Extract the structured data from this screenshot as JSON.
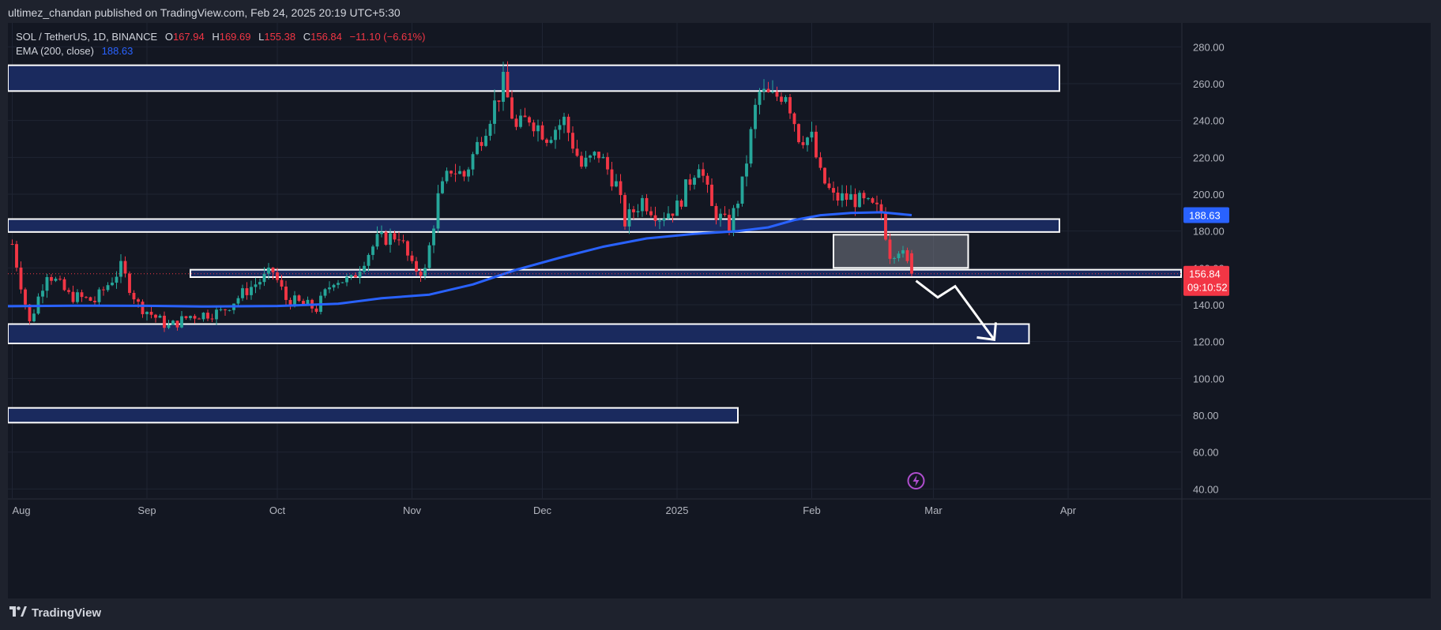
{
  "header": {
    "published_line": "ultimez_chandan published on TradingView.com, Feb 24, 2025 20:19 UTC+5:30"
  },
  "legend": {
    "symbol": "SOL / TetherUS, 1D, BINANCE",
    "open_label": "O",
    "open": "167.94",
    "high_label": "H",
    "high": "169.69",
    "low_label": "L",
    "low": "155.38",
    "close_label": "C",
    "close": "156.84",
    "change": "−11.10 (−6.61%)",
    "ema_label": "EMA (200, close)",
    "ema_value": "188.63"
  },
  "footer": {
    "brand": "TradingView",
    "logo_icon": "tradingview-logo-icon"
  },
  "colors": {
    "up": "#26a69a",
    "down": "#f23645",
    "ema": "#2962ff",
    "zone_fill": "#1a2a5e",
    "zone_stroke": "#ffffff",
    "price_badge": "#f23645"
  },
  "chart_data": {
    "type": "candlestick",
    "symbol": "SOL / TetherUS",
    "timeframe": "1D",
    "exchange": "BINANCE",
    "ylim": [
      35,
      293
    ],
    "y_ticks": [
      "280.00",
      "260.00",
      "240.00",
      "220.00",
      "200.00",
      "180.00",
      "160.00",
      "140.00",
      "120.00",
      "100.00",
      "80.00",
      "60.00",
      "40.00"
    ],
    "y_tick_values": [
      280,
      260,
      240,
      220,
      200,
      180,
      160,
      140,
      120,
      100,
      80,
      60,
      40
    ],
    "x_ticks": [
      "Aug",
      "Sep",
      "Oct",
      "Nov",
      "Dec",
      "2025",
      "Feb",
      "Mar",
      "Apr"
    ],
    "x_tick_dates": [
      "2024-08-01",
      "2024-09-01",
      "2024-10-01",
      "2024-11-01",
      "2024-12-01",
      "2025-01-01",
      "2025-02-01",
      "2025-03-01",
      "2025-04-01"
    ],
    "xlim": [
      "2024-07-31",
      "2025-04-27"
    ],
    "last_price": "156.84",
    "countdown": "09:10:52",
    "ema_badge": "188.63",
    "ema_200": [
      [
        "2024-07-31",
        139.2
      ],
      [
        "2024-08-15",
        139.5
      ],
      [
        "2024-09-01",
        139.4
      ],
      [
        "2024-09-15",
        139.0
      ],
      [
        "2024-10-01",
        139.3
      ],
      [
        "2024-10-15",
        140.5
      ],
      [
        "2024-10-25",
        143.5
      ],
      [
        "2024-11-05",
        145.5
      ],
      [
        "2024-11-15",
        151
      ],
      [
        "2024-11-25",
        159
      ],
      [
        "2024-12-05",
        165.5
      ],
      [
        "2024-12-15",
        171.5
      ],
      [
        "2024-12-25",
        176
      ],
      [
        "2025-01-05",
        178.5
      ],
      [
        "2025-01-15",
        180
      ],
      [
        "2025-01-22",
        182
      ],
      [
        "2025-01-28",
        186
      ],
      [
        "2025-02-03",
        188.6
      ],
      [
        "2025-02-10",
        189.8
      ],
      [
        "2025-02-17",
        190.2
      ],
      [
        "2025-02-24",
        188.63
      ]
    ],
    "zones": [
      {
        "name": "resistance-zone-260",
        "low": 256,
        "high": 270,
        "start": "2024-07-31",
        "end": "2025-03-30"
      },
      {
        "name": "zone-180-185",
        "low": 179.5,
        "high": 186.5,
        "start": "2024-07-31",
        "end": "2025-03-30"
      },
      {
        "name": "support-zone-120",
        "low": 119,
        "high": 129.5,
        "start": "2024-07-31",
        "end": "2025-03-23"
      },
      {
        "name": "support-zone-80",
        "low": 76,
        "high": 84,
        "start": "2024-07-31",
        "end": "2025-01-15"
      },
      {
        "name": "thin-zone-158",
        "low": 155,
        "high": 159,
        "start": "2024-09-11",
        "end": "2025-04-27"
      },
      {
        "name": "consolidation-box",
        "low": 160,
        "high": 178,
        "start": "2025-02-06",
        "end": "2025-03-09",
        "gray": true
      }
    ],
    "projection_arrow": [
      [
        "2025-02-25",
        153
      ],
      [
        "2025-03-02",
        144
      ],
      [
        "2025-03-06",
        150
      ],
      [
        "2025-03-15",
        121
      ]
    ],
    "anchor_close": [
      [
        "2024-08-01",
        173
      ],
      [
        "2024-08-05",
        130
      ],
      [
        "2024-08-09",
        158
      ],
      [
        "2024-08-14",
        145
      ],
      [
        "2024-08-20",
        142
      ],
      [
        "2024-08-26",
        160
      ],
      [
        "2024-08-30",
        140
      ],
      [
        "2024-09-06",
        128
      ],
      [
        "2024-09-11",
        134
      ],
      [
        "2024-09-18",
        136
      ],
      [
        "2024-09-24",
        148
      ],
      [
        "2024-09-30",
        158
      ],
      [
        "2024-10-03",
        143
      ],
      [
        "2024-10-10",
        138
      ],
      [
        "2024-10-14",
        154
      ],
      [
        "2024-10-18",
        153
      ],
      [
        "2024-10-21",
        165
      ],
      [
        "2024-10-24",
        175
      ],
      [
        "2024-10-29",
        178
      ],
      [
        "2024-11-01",
        160
      ],
      [
        "2024-11-04",
        158
      ],
      [
        "2024-11-07",
        198
      ],
      [
        "2024-11-10",
        214
      ],
      [
        "2024-11-13",
        210
      ],
      [
        "2024-11-17",
        232
      ],
      [
        "2024-11-22",
        260
      ],
      [
        "2024-11-25",
        235
      ],
      [
        "2024-11-28",
        242
      ],
      [
        "2024-12-02",
        232
      ],
      [
        "2024-12-06",
        240
      ],
      [
        "2024-12-10",
        215
      ],
      [
        "2024-12-14",
        222
      ],
      [
        "2024-12-18",
        205
      ],
      [
        "2024-12-20",
        185
      ],
      [
        "2024-12-24",
        197
      ],
      [
        "2024-12-28",
        188
      ],
      [
        "2025-01-01",
        193
      ],
      [
        "2025-01-06",
        218
      ],
      [
        "2025-01-09",
        192
      ],
      [
        "2025-01-13",
        182
      ],
      [
        "2025-01-16",
        205
      ],
      [
        "2025-01-19",
        246
      ],
      [
        "2025-01-20",
        255
      ],
      [
        "2025-01-23",
        252
      ],
      [
        "2025-01-26",
        256
      ],
      [
        "2025-01-29",
        232
      ],
      [
        "2025-02-01",
        230
      ],
      [
        "2025-02-03",
        210
      ],
      [
        "2025-02-06",
        198
      ],
      [
        "2025-02-10",
        198
      ],
      [
        "2025-02-13",
        195
      ],
      [
        "2025-02-17",
        190
      ],
      [
        "2025-02-19",
        168
      ],
      [
        "2025-02-21",
        171
      ],
      [
        "2025-02-24",
        156.84
      ]
    ],
    "candle_seed": 7
  }
}
